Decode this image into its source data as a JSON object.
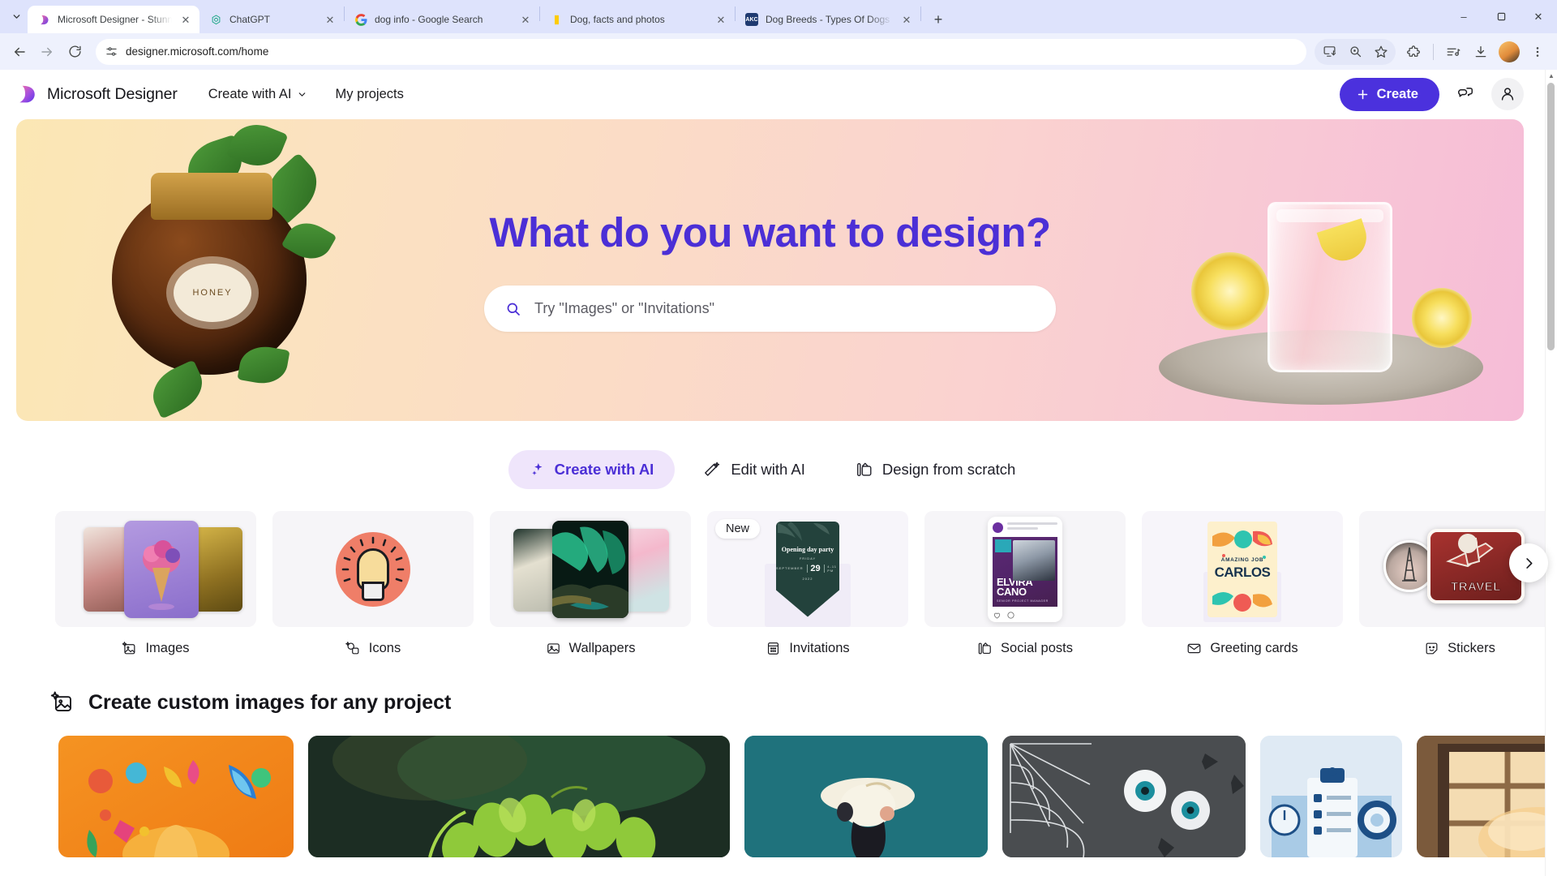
{
  "browser": {
    "tab_search_icon": "chevron-down-icon",
    "tabs": [
      {
        "title": "Microsoft Designer - Stunning designs in a flash",
        "favicon": "designer-logo-icon",
        "active": true
      },
      {
        "title": "ChatGPT",
        "favicon": "chatgpt-icon",
        "active": false
      },
      {
        "title": "dog info - Google Search",
        "favicon": "google-icon",
        "active": false
      },
      {
        "title": "Dog, facts and photos",
        "favicon": "natgeo-icon",
        "active": false
      },
      {
        "title": "Dog Breeds - Types Of Dogs - American Kennel Club",
        "favicon": "akc-icon",
        "active": false
      }
    ],
    "new_tab_label": "+",
    "close_label": "✕",
    "window_controls": {
      "minimize": "–",
      "maximize": "▢",
      "close": "✕"
    },
    "nav": {
      "back": "←",
      "forward": "→",
      "reload": "⟳"
    },
    "omnibox": {
      "url": "designer.microsoft.com/home",
      "site_info_icon": "tune-icon"
    },
    "toolbar_icons": [
      "install-app-icon",
      "zoom-search-icon",
      "bookmark-star-icon",
      "extensions-puzzle-icon",
      "media-controls-icon",
      "downloads-icon",
      "profile-avatar-icon",
      "chrome-menu-icon"
    ]
  },
  "app": {
    "brand": "Microsoft Designer",
    "nav": [
      {
        "label": "Create with AI",
        "has_chevron": true
      },
      {
        "label": "My projects",
        "has_chevron": false
      }
    ],
    "create_button": {
      "label": "Create",
      "plus": "+",
      "color": "#4b31dd"
    },
    "header_icons": [
      "feedback-chat-icon",
      "account-person-icon"
    ]
  },
  "hero": {
    "title": "What do you want to design?",
    "title_color": "#4b2fd6",
    "search": {
      "placeholder": "Try \"Images\" or \"Invitations\"",
      "icon": "search-icon"
    },
    "art_labels": {
      "honey_jar": "HONEY"
    }
  },
  "modes": [
    {
      "label": "Create with AI",
      "icon": "sparkle-icon",
      "active": true
    },
    {
      "label": "Edit with AI",
      "icon": "magic-wand-icon",
      "active": false
    },
    {
      "label": "Design from scratch",
      "icon": "layout-canvas-icon",
      "active": false
    }
  ],
  "categories": {
    "next_arrow_icon": "chevron-right-icon",
    "items": [
      {
        "label": "Images",
        "icon": "image-sparkle-icon",
        "badge": null
      },
      {
        "label": "Icons",
        "icon": "icons-shapes-icon",
        "badge": null
      },
      {
        "label": "Wallpapers",
        "icon": "wallpaper-icon",
        "badge": null
      },
      {
        "label": "Invitations",
        "icon": "invitation-card-icon",
        "badge": "New"
      },
      {
        "label": "Social posts",
        "icon": "social-post-icon",
        "badge": null
      },
      {
        "label": "Greeting cards",
        "icon": "envelope-icon",
        "badge": null
      },
      {
        "label": "Stickers",
        "icon": "sticker-smiley-icon",
        "badge": null
      }
    ],
    "invitation_card": {
      "title": "Opening day party",
      "day_label": "FRIDAY",
      "month": "SEPTEMBER",
      "date": "29",
      "time": "4-11 PM",
      "year": "2022"
    },
    "social_card": {
      "name": "ELVIRA CANO",
      "role": "SENIOR PROJECT MANAGER"
    },
    "greeting_card": {
      "eyebrow": "AMAZING JOB",
      "name": "CARLOS"
    },
    "sticker_card": {
      "label": "TRAVEL"
    }
  },
  "custom_images": {
    "heading": "Create custom images for any project",
    "heading_icon": "image-sparkle-icon",
    "tiles": [
      {
        "name": "halloween-pumpkin-neon"
      },
      {
        "name": "green-olives-dark"
      },
      {
        "name": "teal-hat-portrait"
      },
      {
        "name": "spiderweb-eyeballs"
      },
      {
        "name": "blue-clipboard-illustration"
      },
      {
        "name": "sunlit-window"
      }
    ]
  },
  "scrollbar": {
    "up_arrow": "▲",
    "down_arrow": "▼"
  }
}
